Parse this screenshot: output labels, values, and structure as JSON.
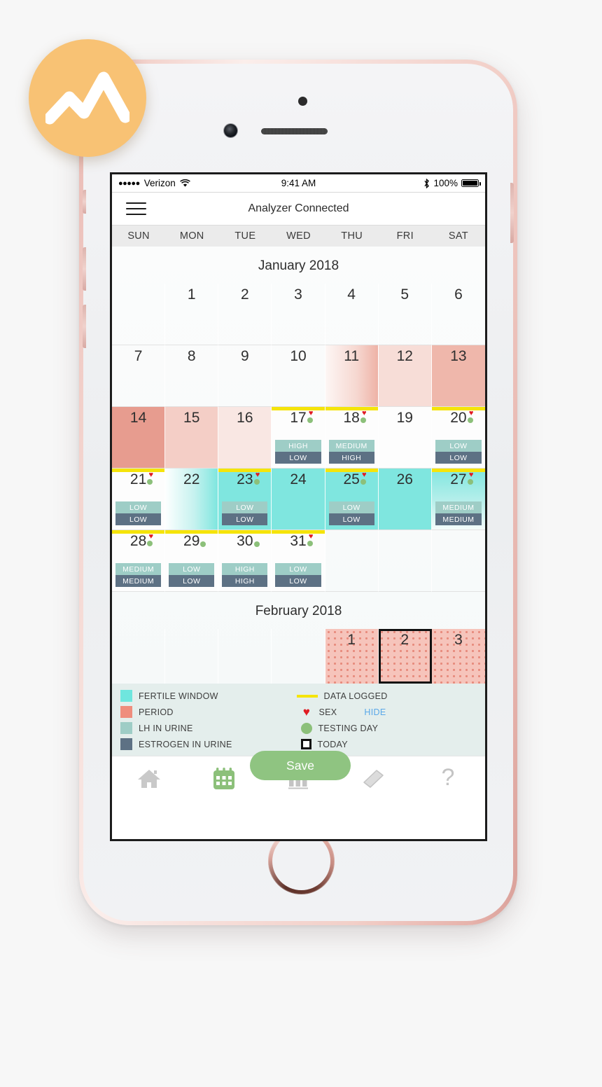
{
  "logo": {
    "name": "analytics-mountain-logo",
    "color": "#f8c274"
  },
  "status_bar": {
    "carrier": "Verizon",
    "signal_dots": "●●●●●",
    "wifi_icon": "wifi-icon",
    "time": "9:41 AM",
    "bluetooth_icon": "ᛦ",
    "battery_percent": "100%"
  },
  "nav": {
    "menu_icon": "hamburger-menu-icon",
    "title": "Analyzer Connected"
  },
  "weekdays": [
    "SUN",
    "MON",
    "TUE",
    "WED",
    "THU",
    "FRI",
    "SAT"
  ],
  "months": [
    {
      "title": "January 2018",
      "weeks": [
        [
          {
            "day": "",
            "bg": "empty"
          },
          {
            "day": "1",
            "bg": "none"
          },
          {
            "day": "2",
            "bg": "none"
          },
          {
            "day": "3",
            "bg": "none"
          },
          {
            "day": "4",
            "bg": "none"
          },
          {
            "day": "5",
            "bg": "none"
          },
          {
            "day": "6",
            "bg": "none"
          }
        ],
        [
          {
            "day": "7",
            "bg": "none"
          },
          {
            "day": "8",
            "bg": "none"
          },
          {
            "day": "9",
            "bg": "none"
          },
          {
            "day": "10",
            "bg": "none"
          },
          {
            "day": "11",
            "bg": "period-fade-r"
          },
          {
            "day": "12",
            "bg": "period-4"
          },
          {
            "day": "13",
            "bg": "period-2"
          }
        ],
        [
          {
            "day": "14",
            "bg": "period-1"
          },
          {
            "day": "15",
            "bg": "period-3"
          },
          {
            "day": "16",
            "bg": "period-5"
          },
          {
            "day": "17",
            "bg": "white",
            "logged": true,
            "sex": true,
            "test": true,
            "lh": "HIGH",
            "est": "LOW"
          },
          {
            "day": "18",
            "bg": "white",
            "logged": true,
            "sex": true,
            "test": true,
            "lh": "MEDIUM",
            "est": "HIGH"
          },
          {
            "day": "19",
            "bg": "white"
          },
          {
            "day": "20",
            "bg": "white",
            "logged": true,
            "sex": true,
            "test": true,
            "lh": "LOW",
            "est": "LOW"
          }
        ],
        [
          {
            "day": "21",
            "bg": "white",
            "logged": true,
            "sex": true,
            "test": true,
            "lh": "LOW",
            "est": "LOW"
          },
          {
            "day": "22",
            "bg": "fert-fade-r"
          },
          {
            "day": "23",
            "bg": "fert",
            "logged": true,
            "sex": true,
            "test": true,
            "lh": "LOW",
            "est": "LOW"
          },
          {
            "day": "24",
            "bg": "fert"
          },
          {
            "day": "25",
            "bg": "fert",
            "logged": true,
            "sex": true,
            "test": true,
            "lh": "LOW",
            "est": "LOW"
          },
          {
            "day": "26",
            "bg": "fert"
          },
          {
            "day": "27",
            "bg": "fert-fade-d",
            "logged": true,
            "sex": true,
            "test": true,
            "lh": "MEDIUM",
            "est": "MEDIUM"
          }
        ],
        [
          {
            "day": "28",
            "bg": "white",
            "logged": true,
            "sex": true,
            "test": true,
            "lh": "MEDIUM",
            "est": "MEDIUM"
          },
          {
            "day": "29",
            "bg": "white",
            "logged": true,
            "sex": false,
            "test": true,
            "lh": "LOW",
            "est": "LOW"
          },
          {
            "day": "30",
            "bg": "white",
            "logged": true,
            "sex": false,
            "test": true,
            "lh": "HIGH",
            "est": "HIGH"
          },
          {
            "day": "31",
            "bg": "white",
            "logged": true,
            "sex": true,
            "test": true,
            "lh": "LOW",
            "est": "LOW"
          },
          {
            "day": "",
            "bg": "empty"
          },
          {
            "day": "",
            "bg": "empty"
          },
          {
            "day": "",
            "bg": "empty"
          }
        ]
      ]
    },
    {
      "title": "February 2018",
      "weeks": [
        [
          {
            "day": "",
            "bg": "empty"
          },
          {
            "day": "",
            "bg": "empty"
          },
          {
            "day": "",
            "bg": "empty"
          },
          {
            "day": "",
            "bg": "empty"
          },
          {
            "day": "1",
            "bg": "dotted-period"
          },
          {
            "day": "2",
            "bg": "dotted-period",
            "today": true
          },
          {
            "day": "3",
            "bg": "dotted-period"
          }
        ]
      ]
    }
  ],
  "save_button": {
    "label": "Save",
    "color": "#8fc481"
  },
  "legend": {
    "left": [
      {
        "swatch": "fert",
        "label": "FERTILE WINDOW",
        "color": "#6fe6de"
      },
      {
        "swatch": "period",
        "label": "PERIOD",
        "color": "#ef8d7d"
      },
      {
        "swatch": "lh",
        "label": "LH IN URINE",
        "color": "#9ecdc6"
      },
      {
        "swatch": "est",
        "label": "ESTROGEN IN URINE",
        "color": "#5d7184"
      }
    ],
    "right": [
      {
        "swatch": "line",
        "label": "DATA LOGGED",
        "color": "#f5e40a"
      },
      {
        "swatch": "heart",
        "label": "SEX",
        "color": "#e01b22",
        "action": "HIDE"
      },
      {
        "swatch": "circle",
        "label": "TESTING DAY",
        "color": "#8cc07a"
      },
      {
        "swatch": "square",
        "label": "TODAY",
        "color": "#111111"
      }
    ]
  },
  "tabs": [
    {
      "icon": "home-icon",
      "active": false
    },
    {
      "icon": "calendar-icon",
      "active": true
    },
    {
      "icon": "bar-chart-icon",
      "active": false
    },
    {
      "icon": "book-icon",
      "active": false
    },
    {
      "icon": "help-icon",
      "active": false
    }
  ]
}
